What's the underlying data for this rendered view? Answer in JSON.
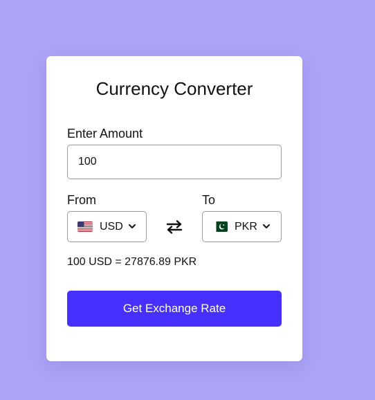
{
  "card": {
    "title": "Currency Converter",
    "amount_label": "Enter Amount",
    "amount_value": "100",
    "from_label": "From",
    "to_label": "To",
    "from_currency": {
      "code": "USD",
      "flag_icon": "us-flag-icon"
    },
    "to_currency": {
      "code": "PKR",
      "flag_icon": "pk-flag-icon"
    },
    "result_text": "100 USD = 27876.89 PKR",
    "button_label": "Get Exchange Rate"
  },
  "colors": {
    "background": "#aba3f7",
    "card": "#ffffff",
    "button": "#4630ff",
    "button_text": "#ffffff"
  }
}
